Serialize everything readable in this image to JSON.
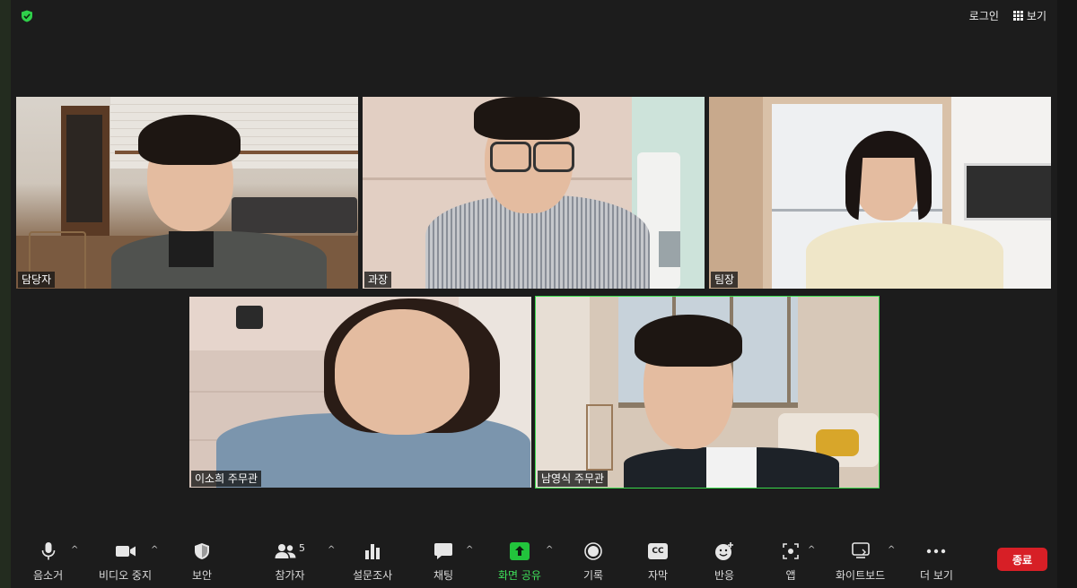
{
  "topbar": {
    "login": "로그인",
    "view": "보기"
  },
  "participants": [
    {
      "name": "담당자"
    },
    {
      "name": "과장"
    },
    {
      "name": "팀장"
    },
    {
      "name": "이소희 주무관"
    },
    {
      "name": "남영식 주무관",
      "active": true
    }
  ],
  "toolbar": {
    "mute": "음소거",
    "stop_video": "비디오 중지",
    "security": "보안",
    "participants": "참가자",
    "participant_count": "5",
    "polls": "설문조사",
    "chat": "채팅",
    "share_screen": "화면 공유",
    "record": "기록",
    "captions": "자막",
    "captions_icon": "CC",
    "reactions": "반응",
    "apps": "앱",
    "whiteboard": "화이트보드",
    "more": "더 보기",
    "end": "종료"
  },
  "colors": {
    "accent_green": "#38d84a",
    "end_red": "#d71f26",
    "background": "#1c1c1c"
  },
  "icons": {
    "security_status": "shield-check-icon",
    "view": "grid-icon",
    "mute": "microphone-icon",
    "stop_video": "video-camera-icon",
    "security": "shield-icon",
    "participants": "people-icon",
    "polls": "bar-chart-icon",
    "chat": "chat-bubble-icon",
    "share_screen": "share-arrow-icon",
    "record": "record-icon",
    "captions": "cc-icon",
    "reactions": "emoji-plus-icon",
    "apps": "apps-icon",
    "whiteboard": "whiteboard-icon",
    "more": "ellipsis-icon"
  }
}
